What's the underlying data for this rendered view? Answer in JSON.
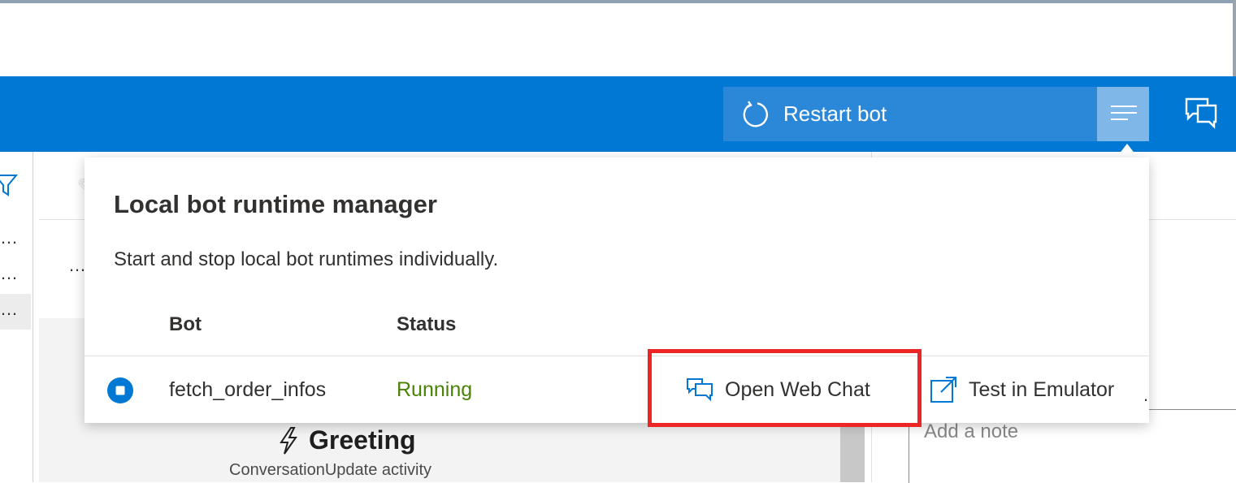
{
  "toolbar": {
    "restart_label": "Restart bot",
    "restart_icon": "restart-icon",
    "menu_icon": "menu-lines-icon",
    "chat_icon": "web-chat-icon"
  },
  "background": {
    "greeting_title": "Greeting",
    "greeting_subtitle": "ConversationUpdate activity",
    "note_placeholder": "Add a note"
  },
  "popup": {
    "title": "Local bot runtime manager",
    "description": "Start and stop local bot runtimes individually.",
    "columns": {
      "bot": "Bot",
      "status": "Status"
    },
    "rows": [
      {
        "bot": "fetch_order_infos",
        "status": "Running",
        "open_web_chat": "Open Web Chat",
        "test_in_emulator": "Test in Emulator"
      }
    ]
  },
  "colors": {
    "brand_blue": "#0078d4",
    "running_green": "#498205",
    "highlight_red": "#ee2525"
  }
}
